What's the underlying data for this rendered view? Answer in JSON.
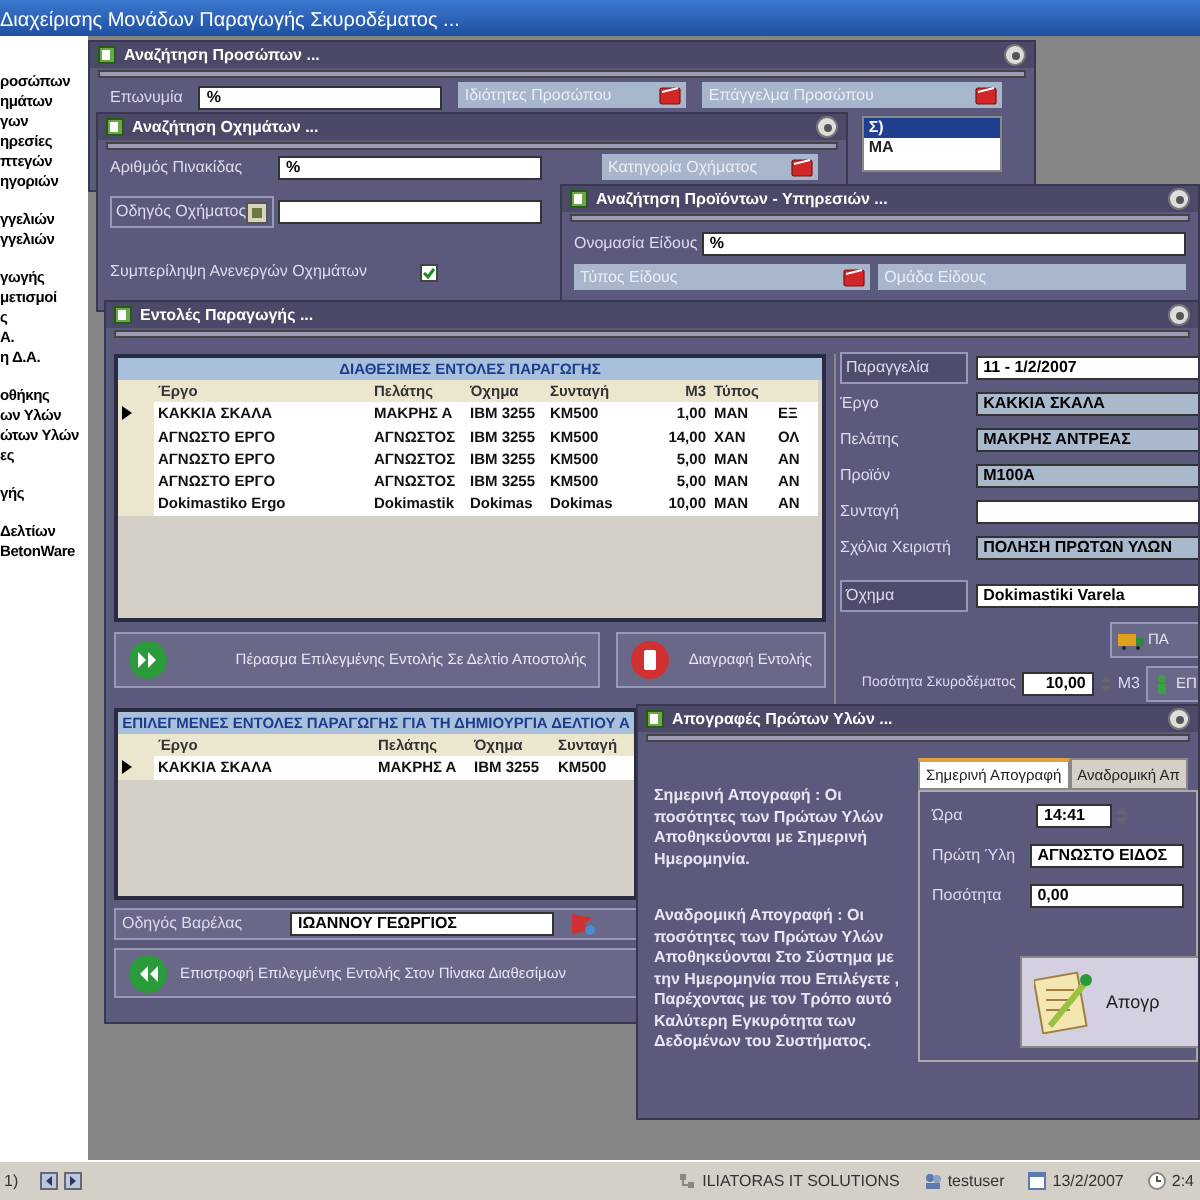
{
  "window": {
    "title": "Διαχείρισης Μονάδων Παραγωγής  Σκυροδέματος ..."
  },
  "sidebar": {
    "groups": [
      {
        "items": [
          "ροσώπων",
          "ημάτων",
          "γων",
          "ηρεσίες",
          "πτεγών",
          "ηγοριών"
        ]
      },
      {
        "items": [
          "γγελιών",
          "γγελιών"
        ]
      },
      {
        "items": [
          "γωγής",
          "μετισμοί",
          "ς",
          "Α.",
          "η Δ.Α."
        ]
      },
      {
        "items": [
          "οθήκης",
          "ων Υλών",
          "ώτων Υλών",
          "ες"
        ]
      },
      {
        "items": [
          "γής"
        ]
      },
      {
        "items": [
          "Δελτίων",
          "BetonWare"
        ]
      }
    ]
  },
  "person_search": {
    "title": "Αναζήτηση Προσώπων ...",
    "name_field": {
      "label": "Επωνυμία",
      "value": "%"
    },
    "properties_header": "Ιδιότητες Προσώπου",
    "profession_header": "Επάγγελμα Προσώπου",
    "profession_list": [
      {
        "text": "Σ)",
        "selected": true
      },
      {
        "text": "ΜΑ",
        "selected": false
      }
    ]
  },
  "vehicle_search": {
    "title": "Αναζήτηση Οχημάτων ...",
    "plate_field": {
      "label": "Αριθμός Πινακίδας",
      "value": "%"
    },
    "driver_field": {
      "label": "Οδηγός Οχήματος"
    },
    "category_header": "Κατηγορία Οχήματος",
    "include_inactive": {
      "label": "Συμπερίληψη Ανενεργών Οχημάτων",
      "checked": true
    }
  },
  "product_search": {
    "title": "Αναζήτηση Προϊόντων - Υπηρεσιών ...",
    "name_field": {
      "label": "Ονομασία Είδους",
      "value": "%"
    },
    "type_header": "Τύπος Είδους",
    "group_header": "Ομάδα Είδους"
  },
  "production_orders": {
    "title": "Εντολές Παραγωγής ...",
    "available": {
      "title": "ΔΙΑΘΕΣΙΜΕΣ ΕΝΤΟΛΕΣ ΠΑΡΑΓΩΓΗΣ",
      "columns": [
        "Έργο",
        "Πελάτης",
        "Όχημα",
        "Συνταγή",
        "M3",
        "Τύπος"
      ],
      "rows": [
        {
          "cells": [
            "ΚΑΚΚΙΑ ΣΚΑΛΑ",
            "ΜΑΚΡΗΣ Α",
            "IBM 3255",
            "KM500",
            "1,00",
            "MAN",
            "ΕΞ"
          ],
          "selected": true
        },
        {
          "cells": [
            "ΑΓΝΩΣΤΟ ΕΡΓΟ",
            "ΑΓΝΩΣΤΟΣ",
            "IBM 3255",
            "KM500",
            "14,00",
            "XAN",
            "ΟΛ"
          ],
          "selected": false
        },
        {
          "cells": [
            "ΑΓΝΩΣΤΟ ΕΡΓΟ",
            "ΑΓΝΩΣΤΟΣ",
            "IBM 3255",
            "KM500",
            "5,00",
            "MAN",
            "ΑΝ"
          ],
          "selected": false
        },
        {
          "cells": [
            "ΑΓΝΩΣΤΟ ΕΡΓΟ",
            "ΑΓΝΩΣΤΟΣ",
            "IBM 3255",
            "KM500",
            "5,00",
            "MAN",
            "ΑΝ"
          ],
          "selected": false
        },
        {
          "cells": [
            "Dokimastiko Ergo",
            "Dokimastik",
            "Dokimas",
            "Dokimas",
            "10,00",
            "MAN",
            "ΑΝ"
          ],
          "selected": false
        }
      ]
    },
    "move_button": "Πέρασμα Επιλεγμένης Εντολής Σε Δελτίο Αποστολής",
    "delete_button": "Διαγραφή Εντολής",
    "details": {
      "fields": [
        {
          "label": "Παραγγελία",
          "value": "11 - 1/2/2007",
          "framed": true,
          "readonly": false
        },
        {
          "label": "Έργο",
          "value": "ΚΑΚΚΙΑ ΣΚΑΛΑ",
          "framed": false,
          "readonly": true
        },
        {
          "label": "Πελάτης",
          "value": "ΜΑΚΡΗΣ ΑΝΤΡΕΑΣ",
          "framed": false,
          "readonly": true
        },
        {
          "label": "Προϊόν",
          "value": "M100A",
          "framed": false,
          "readonly": true
        },
        {
          "label": "Συνταγή",
          "framed": false,
          "readonly": false
        },
        {
          "label": "Σχόλια Χειριστή",
          "value": "ΠΟΛΗΣΗ ΠΡΩΤΩΝ ΥΛΩΝ",
          "framed": false,
          "readonly": true
        },
        {
          "label": "Όχημα",
          "value": "Dokimastiki Varela",
          "framed": true,
          "readonly": false
        }
      ],
      "quantity": {
        "label": "Ποσότητα Σκυροδέματος",
        "value": "10,00",
        "unit": "M3"
      },
      "buttons": [
        "ΠΑ",
        "ΕΠ"
      ]
    },
    "selected": {
      "title": "ΕΠΙΛΕΓΜΕΝΕΣ ΕΝΤΟΛΕΣ ΠΑΡΑΓΩΓΗΣ ΓΙΑ ΤΗ ΔΗΜΙΟΥΡΓΙΑ ΔΕΛΤΙΟΥ Α",
      "columns": [
        "Έργο",
        "Πελάτης",
        "Όχημα",
        "Συνταγή"
      ],
      "rows": [
        {
          "cells": [
            "ΚΑΚΚΙΑ ΣΚΑΛΑ",
            "ΜΑΚΡΗΣ Α",
            "IBM 3255",
            "KM500"
          ],
          "selected": true
        }
      ]
    },
    "driver": {
      "label": "Οδηγός Βαρέλας",
      "value": "ΙΩΑΝΝΟΥ ΓΕΩΡΓΙΟΣ"
    },
    "return_button": "Επιστροφή Επιλεγμένης Εντολής Στον Πίνακα Διαθεσίμων"
  },
  "inventory": {
    "title": "Απογραφές Πρώτων Υλών ...",
    "notes": [
      "Σημερινή Απογραφή : Οι ποσότητες των Πρώτων Υλών Αποθηκεύονται με Σημερινή Ημερομηνία.",
      "Αναδρομική Απογραφή : Οι ποσότητες των Πρώτων Υλών Αποθηκεύονται Στο Σύστημα με την Ημερομηνία που Επιλέγετε , Παρέχοντας με τον Τρόπο αυτό Καλύτερη Εγκυρότητα των Δεδομένων του Συστήματος."
    ],
    "tabs": [
      {
        "label": "Σημερινή Απογραφή",
        "selected": true
      },
      {
        "label": "Αναδρομική Απ",
        "selected": false
      }
    ],
    "fields": [
      {
        "label": "Ώρα",
        "value": "14:41",
        "kind": "time"
      },
      {
        "label": "Πρώτη Ύλη",
        "value": "ΑΓΝΩΣΤΟ ΕΙΔΟΣ",
        "kind": "text"
      },
      {
        "label": "Ποσότητα",
        "value": "0,00",
        "kind": "text"
      }
    ],
    "save_button": "Απογρ"
  },
  "status_bar": {
    "record": "1)",
    "company": "ILIATORAS IT SOLUTIONS",
    "user": "testuser",
    "date": "13/2/2007",
    "time": "2:4"
  }
}
